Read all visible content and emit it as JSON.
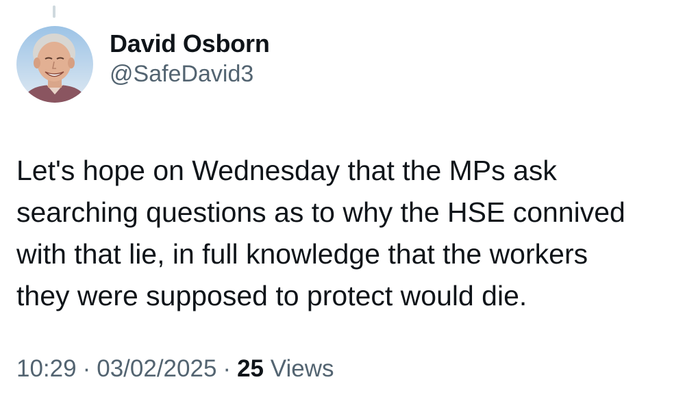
{
  "author": {
    "display_name": "David Osborn",
    "handle": "@SafeDavid3"
  },
  "tweet": {
    "lines": [
      "Let's hope on Wednesday that the MPs ask",
      "searching questions as to why the HSE connived",
      "with that lie, in full knowledge that the workers",
      "they were supposed to protect would die."
    ]
  },
  "meta": {
    "time": "10:29",
    "date": "03/02/2025",
    "separator": "·",
    "views_count": "25",
    "views_label": "Views"
  },
  "colors": {
    "text": "#0f1419",
    "secondary": "#536471",
    "thread_line": "#cfd9de"
  }
}
